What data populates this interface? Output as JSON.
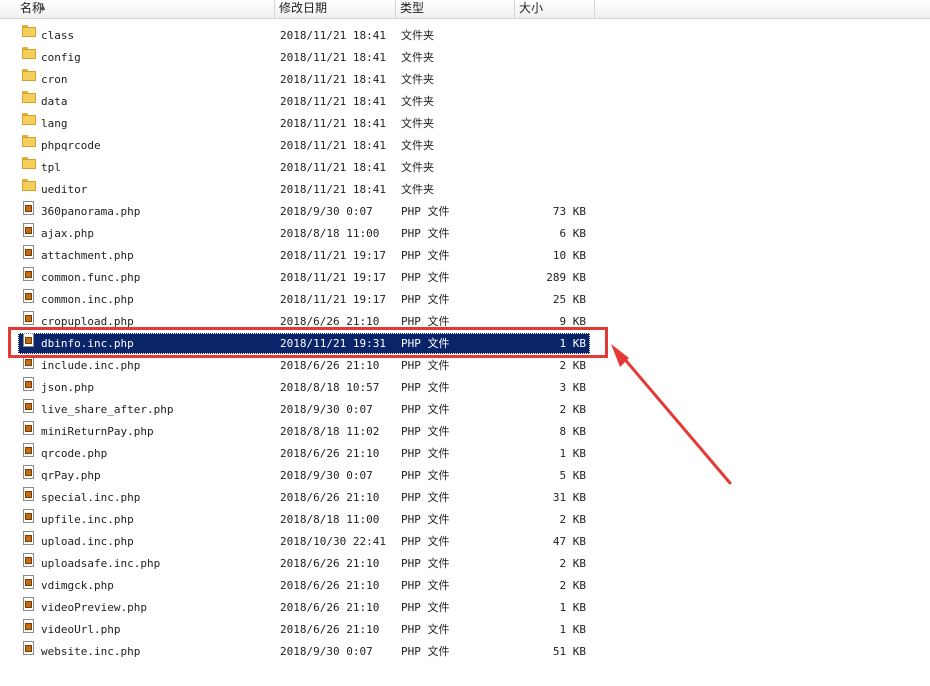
{
  "columns": {
    "name": "名称",
    "date": "修改日期",
    "type": "类型",
    "size": "大小"
  },
  "files": [
    {
      "name": "class",
      "date": "2018/11/21 18:41",
      "type": "文件夹",
      "size": "",
      "kind": "folder"
    },
    {
      "name": "config",
      "date": "2018/11/21 18:41",
      "type": "文件夹",
      "size": "",
      "kind": "folder"
    },
    {
      "name": "cron",
      "date": "2018/11/21 18:41",
      "type": "文件夹",
      "size": "",
      "kind": "folder"
    },
    {
      "name": "data",
      "date": "2018/11/21 18:41",
      "type": "文件夹",
      "size": "",
      "kind": "folder"
    },
    {
      "name": "lang",
      "date": "2018/11/21 18:41",
      "type": "文件夹",
      "size": "",
      "kind": "folder"
    },
    {
      "name": "phpqrcode",
      "date": "2018/11/21 18:41",
      "type": "文件夹",
      "size": "",
      "kind": "folder"
    },
    {
      "name": "tpl",
      "date": "2018/11/21 18:41",
      "type": "文件夹",
      "size": "",
      "kind": "folder"
    },
    {
      "name": "ueditor",
      "date": "2018/11/21 18:41",
      "type": "文件夹",
      "size": "",
      "kind": "folder"
    },
    {
      "name": "360panorama.php",
      "date": "2018/9/30 0:07",
      "type": "PHP 文件",
      "size": "73 KB",
      "kind": "file"
    },
    {
      "name": "ajax.php",
      "date": "2018/8/18 11:00",
      "type": "PHP 文件",
      "size": "6 KB",
      "kind": "file"
    },
    {
      "name": "attachment.php",
      "date": "2018/11/21 19:17",
      "type": "PHP 文件",
      "size": "10 KB",
      "kind": "file"
    },
    {
      "name": "common.func.php",
      "date": "2018/11/21 19:17",
      "type": "PHP 文件",
      "size": "289 KB",
      "kind": "file"
    },
    {
      "name": "common.inc.php",
      "date": "2018/11/21 19:17",
      "type": "PHP 文件",
      "size": "25 KB",
      "kind": "file"
    },
    {
      "name": "cropupload.php",
      "date": "2018/6/26 21:10",
      "type": "PHP 文件",
      "size": "9 KB",
      "kind": "file"
    },
    {
      "name": "dbinfo.inc.php",
      "date": "2018/11/21 19:31",
      "type": "PHP 文件",
      "size": "1 KB",
      "kind": "file",
      "selected": true
    },
    {
      "name": "include.inc.php",
      "date": "2018/6/26 21:10",
      "type": "PHP 文件",
      "size": "2 KB",
      "kind": "file"
    },
    {
      "name": "json.php",
      "date": "2018/8/18 10:57",
      "type": "PHP 文件",
      "size": "3 KB",
      "kind": "file"
    },
    {
      "name": "live_share_after.php",
      "date": "2018/9/30 0:07",
      "type": "PHP 文件",
      "size": "2 KB",
      "kind": "file"
    },
    {
      "name": "miniReturnPay.php",
      "date": "2018/8/18 11:02",
      "type": "PHP 文件",
      "size": "8 KB",
      "kind": "file"
    },
    {
      "name": "qrcode.php",
      "date": "2018/6/26 21:10",
      "type": "PHP 文件",
      "size": "1 KB",
      "kind": "file"
    },
    {
      "name": "qrPay.php",
      "date": "2018/9/30 0:07",
      "type": "PHP 文件",
      "size": "5 KB",
      "kind": "file"
    },
    {
      "name": "special.inc.php",
      "date": "2018/6/26 21:10",
      "type": "PHP 文件",
      "size": "31 KB",
      "kind": "file"
    },
    {
      "name": "upfile.inc.php",
      "date": "2018/8/18 11:00",
      "type": "PHP 文件",
      "size": "2 KB",
      "kind": "file"
    },
    {
      "name": "upload.inc.php",
      "date": "2018/10/30 22:41",
      "type": "PHP 文件",
      "size": "47 KB",
      "kind": "file"
    },
    {
      "name": "uploadsafe.inc.php",
      "date": "2018/6/26 21:10",
      "type": "PHP 文件",
      "size": "2 KB",
      "kind": "file"
    },
    {
      "name": "vdimgck.php",
      "date": "2018/6/26 21:10",
      "type": "PHP 文件",
      "size": "2 KB",
      "kind": "file"
    },
    {
      "name": "videoPreview.php",
      "date": "2018/6/26 21:10",
      "type": "PHP 文件",
      "size": "1 KB",
      "kind": "file"
    },
    {
      "name": "videoUrl.php",
      "date": "2018/6/26 21:10",
      "type": "PHP 文件",
      "size": "1 KB",
      "kind": "file"
    },
    {
      "name": "website.inc.php",
      "date": "2018/9/30 0:07",
      "type": "PHP 文件",
      "size": "51 KB",
      "kind": "file"
    }
  ],
  "colors": {
    "selection": "#0a246a",
    "annotation": "#e53935",
    "folder": "#f4cf5c"
  },
  "icons": {
    "folder": "folder-icon",
    "file": "php-file-icon"
  }
}
